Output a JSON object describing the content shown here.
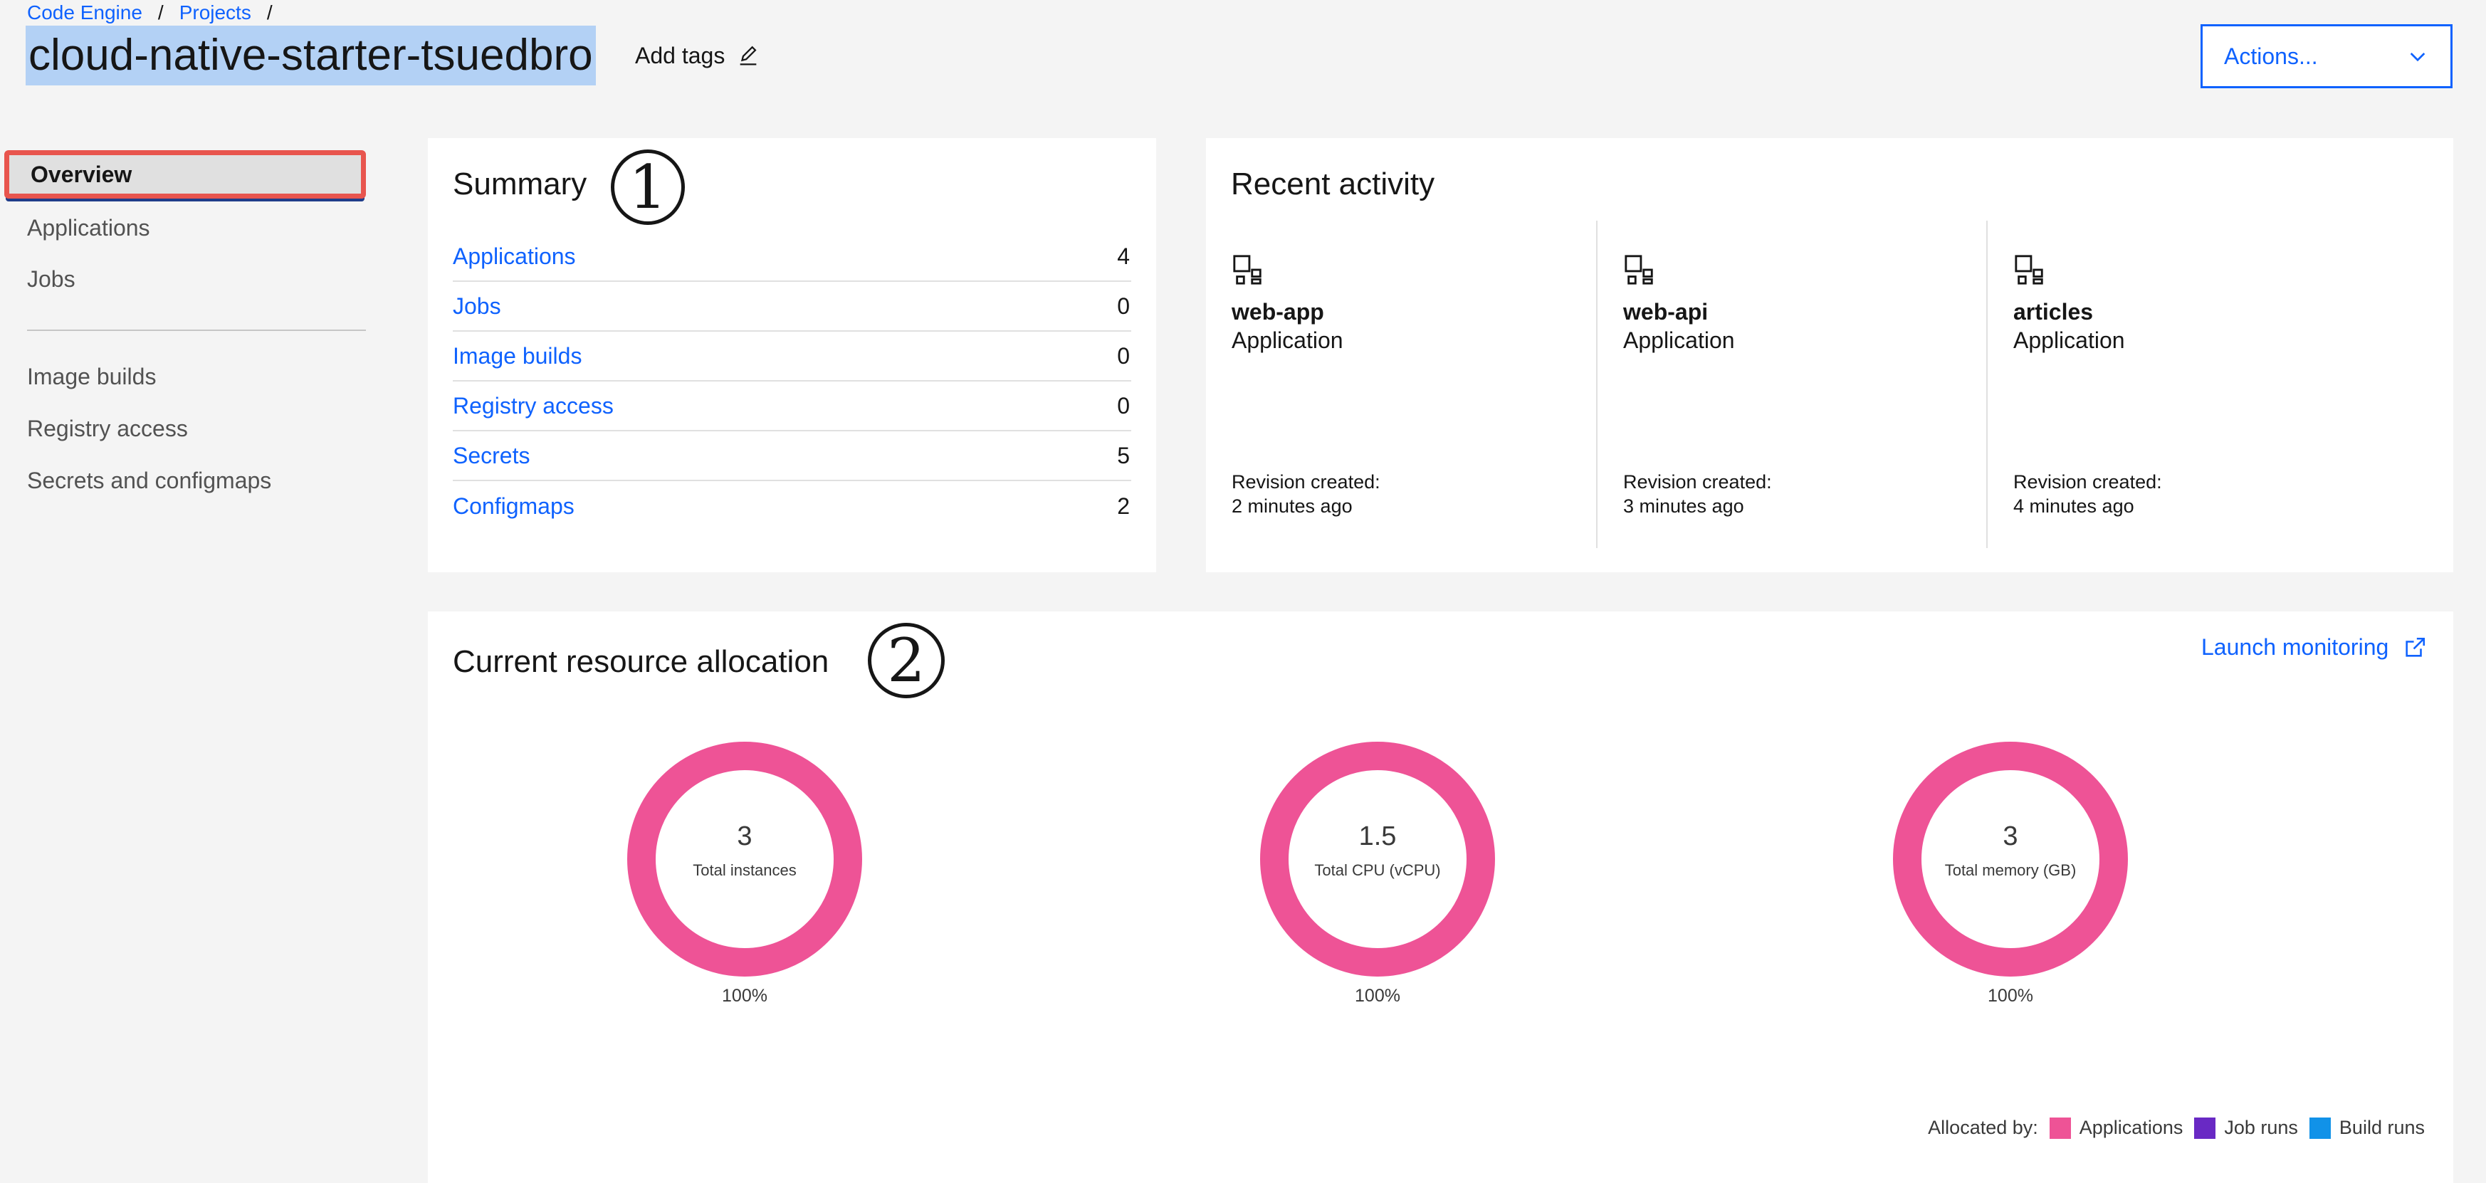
{
  "breadcrumb": {
    "items": [
      "Code Engine",
      "Projects"
    ],
    "separator": "/"
  },
  "page": {
    "title": "cloud-native-starter-tsuedbro",
    "add_tags": "Add tags"
  },
  "actions": {
    "label": "Actions..."
  },
  "sidebar": {
    "items": [
      {
        "label": "Overview",
        "active": true
      },
      {
        "label": "Applications"
      },
      {
        "label": "Jobs"
      },
      {
        "label": "Image builds"
      },
      {
        "label": "Registry access"
      },
      {
        "label": "Secrets and configmaps"
      }
    ]
  },
  "summary": {
    "title": "Summary",
    "annotation": "1",
    "rows": [
      {
        "label": "Applications",
        "count": "4"
      },
      {
        "label": "Jobs",
        "count": "0"
      },
      {
        "label": "Image builds",
        "count": "0"
      },
      {
        "label": "Registry access",
        "count": "0"
      },
      {
        "label": "Secrets",
        "count": "5"
      },
      {
        "label": "Configmaps",
        "count": "2"
      }
    ]
  },
  "activity": {
    "title": "Recent activity",
    "items": [
      {
        "name": "web-app",
        "type": "Application",
        "revision_label": "Revision created:",
        "time": "2 minutes ago"
      },
      {
        "name": "web-api",
        "type": "Application",
        "revision_label": "Revision created:",
        "time": "3 minutes ago"
      },
      {
        "name": "articles",
        "type": "Application",
        "revision_label": "Revision created:",
        "time": "4 minutes ago"
      }
    ]
  },
  "resources": {
    "title": "Current resource allocation",
    "annotation": "2",
    "launch_label": "Launch monitoring",
    "donuts": [
      {
        "value": "3",
        "label": "Total instances",
        "percent": "100%"
      },
      {
        "value": "1.5",
        "label": "Total CPU (vCPU)",
        "percent": "100%"
      },
      {
        "value": "3",
        "label": "Total memory (GB)",
        "percent": "100%"
      }
    ],
    "legend": {
      "prefix": "Allocated by:",
      "items": [
        {
          "label": "Applications",
          "color": "#ee5396"
        },
        {
          "label": "Job runs",
          "color": "#6929c4"
        },
        {
          "label": "Build runs",
          "color": "#1192e8"
        }
      ]
    }
  },
  "colors": {
    "accent": "#0f62fe",
    "highlight": "#b3d1f5",
    "active_outline": "#e8554e"
  }
}
